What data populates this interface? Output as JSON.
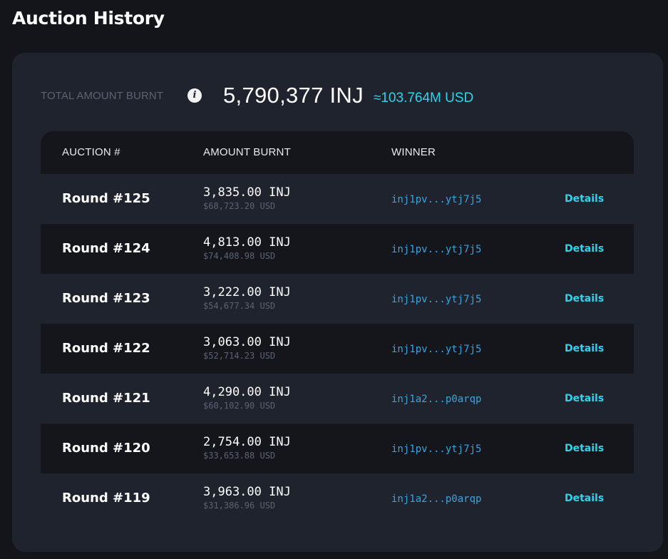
{
  "page": {
    "title": "Auction History"
  },
  "summary": {
    "label": "TOTAL AMOUNT BURNT",
    "info_glyph": "i",
    "total": "5,790,377 INJ",
    "usd": "≈103.764M USD"
  },
  "table": {
    "headers": {
      "auction": "AUCTION #",
      "amount": "AMOUNT BURNT",
      "winner": "WINNER"
    },
    "rows": [
      {
        "round": "Round #125",
        "amount": "3,835.00 INJ",
        "usd": "$68,723.20 USD",
        "winner": "inj1pv...ytj7j5",
        "action": "Details"
      },
      {
        "round": "Round #124",
        "amount": "4,813.00 INJ",
        "usd": "$74,408.98 USD",
        "winner": "inj1pv...ytj7j5",
        "action": "Details"
      },
      {
        "round": "Round #123",
        "amount": "3,222.00 INJ",
        "usd": "$54,677.34 USD",
        "winner": "inj1pv...ytj7j5",
        "action": "Details"
      },
      {
        "round": "Round #122",
        "amount": "3,063.00 INJ",
        "usd": "$52,714.23 USD",
        "winner": "inj1pv...ytj7j5",
        "action": "Details"
      },
      {
        "round": "Round #121",
        "amount": "4,290.00 INJ",
        "usd": "$60,102.90 USD",
        "winner": "inj1a2...p0arqp",
        "action": "Details"
      },
      {
        "round": "Round #120",
        "amount": "2,754.00 INJ",
        "usd": "$33,653.88 USD",
        "winner": "inj1pv...ytj7j5",
        "action": "Details"
      },
      {
        "round": "Round #119",
        "amount": "3,963.00 INJ",
        "usd": "$31,386.96 USD",
        "winner": "inj1a2...p0arqp",
        "action": "Details"
      }
    ]
  },
  "colors": {
    "page_bg": "#13151b",
    "card_bg": "#1f232d",
    "row_alt_bg": "#14161c",
    "accent": "#2fd3ec",
    "link": "#3aa3e0",
    "muted": "#5b6272"
  }
}
